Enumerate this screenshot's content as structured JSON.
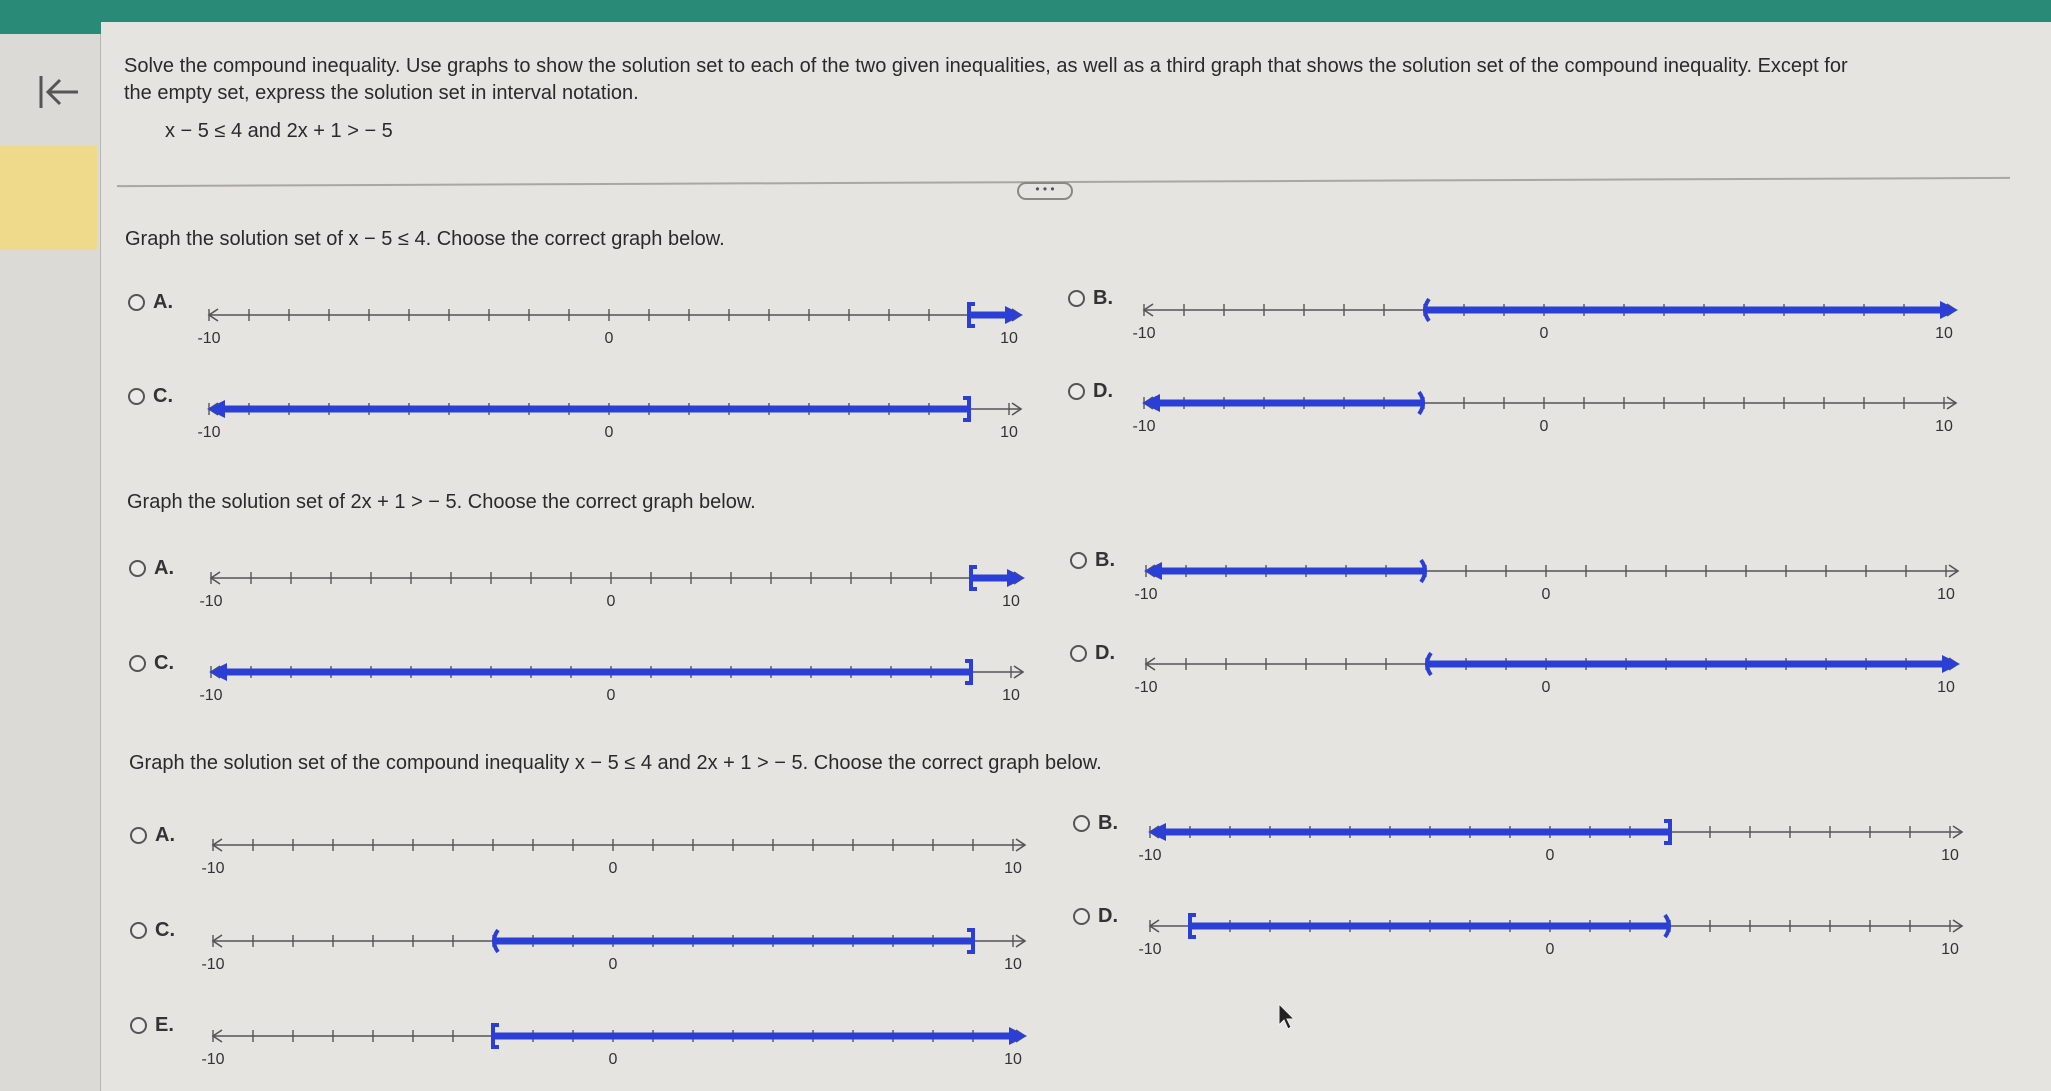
{
  "problem": {
    "instructions_line1": "Solve the compound inequality. Use graphs to show the solution set to each of the two given inequalities, as well as a third graph that shows the solution set of the compound inequality. Except for",
    "instructions_line2": "the empty set, express the solution set in interval notation.",
    "inequality": "x − 5 ≤ 4 and 2x + 1 > − 5"
  },
  "more_button": "• • •",
  "axis_labels": {
    "min": "-10",
    "zero": "0",
    "max": "10"
  },
  "questions": [
    {
      "heading": "Graph the solution set of x − 5 ≤ 4. Choose the correct graph below.",
      "options": [
        {
          "label": "A.",
          "graph": {
            "from": 9,
            "to": 10,
            "from_type": "bracket",
            "to_type": "arrow"
          }
        },
        {
          "label": "B.",
          "graph": {
            "from": -3,
            "to": 10,
            "from_type": "paren",
            "to_type": "arrow"
          }
        },
        {
          "label": "C.",
          "graph": {
            "from": -10,
            "to": 9,
            "from_type": "arrow",
            "to_type": "bracket"
          }
        },
        {
          "label": "D.",
          "graph": {
            "from": -10,
            "to": -3,
            "from_type": "arrow",
            "to_type": "paren"
          }
        }
      ]
    },
    {
      "heading": "Graph the solution set of 2x + 1 > − 5. Choose the correct graph below.",
      "options": [
        {
          "label": "A.",
          "graph": {
            "from": 9,
            "to": 10,
            "from_type": "bracket",
            "to_type": "arrow"
          }
        },
        {
          "label": "B.",
          "graph": {
            "from": -10,
            "to": -3,
            "from_type": "arrow",
            "to_type": "paren"
          }
        },
        {
          "label": "C.",
          "graph": {
            "from": -10,
            "to": 9,
            "from_type": "arrow",
            "to_type": "bracket"
          }
        },
        {
          "label": "D.",
          "graph": {
            "from": -3,
            "to": 10,
            "from_type": "paren",
            "to_type": "arrow"
          }
        }
      ]
    },
    {
      "heading": "Graph the solution set of the compound inequality x − 5 ≤ 4 and 2x + 1 > − 5. Choose the correct graph below.",
      "options": [
        {
          "label": "A.",
          "graph": null
        },
        {
          "label": "B.",
          "graph": {
            "from": -9,
            "to": 3,
            "from_type": "arrow",
            "to_type": "bracket"
          }
        },
        {
          "label": "C.",
          "graph": {
            "from": -3,
            "to": 9,
            "from_type": "paren",
            "to_type": "bracket"
          }
        },
        {
          "label": "D.",
          "graph": {
            "from": -9,
            "to": 3,
            "from_type": "bracket",
            "to_type": "paren"
          }
        },
        {
          "label": "E.",
          "graph": {
            "from": -3,
            "to": 9,
            "from_type": "bracket",
            "to_type": "arrow"
          }
        }
      ]
    }
  ],
  "colors": {
    "solution": "#2b3fd6",
    "topbar": "#2a8a78",
    "highlight": "#efd98a"
  }
}
